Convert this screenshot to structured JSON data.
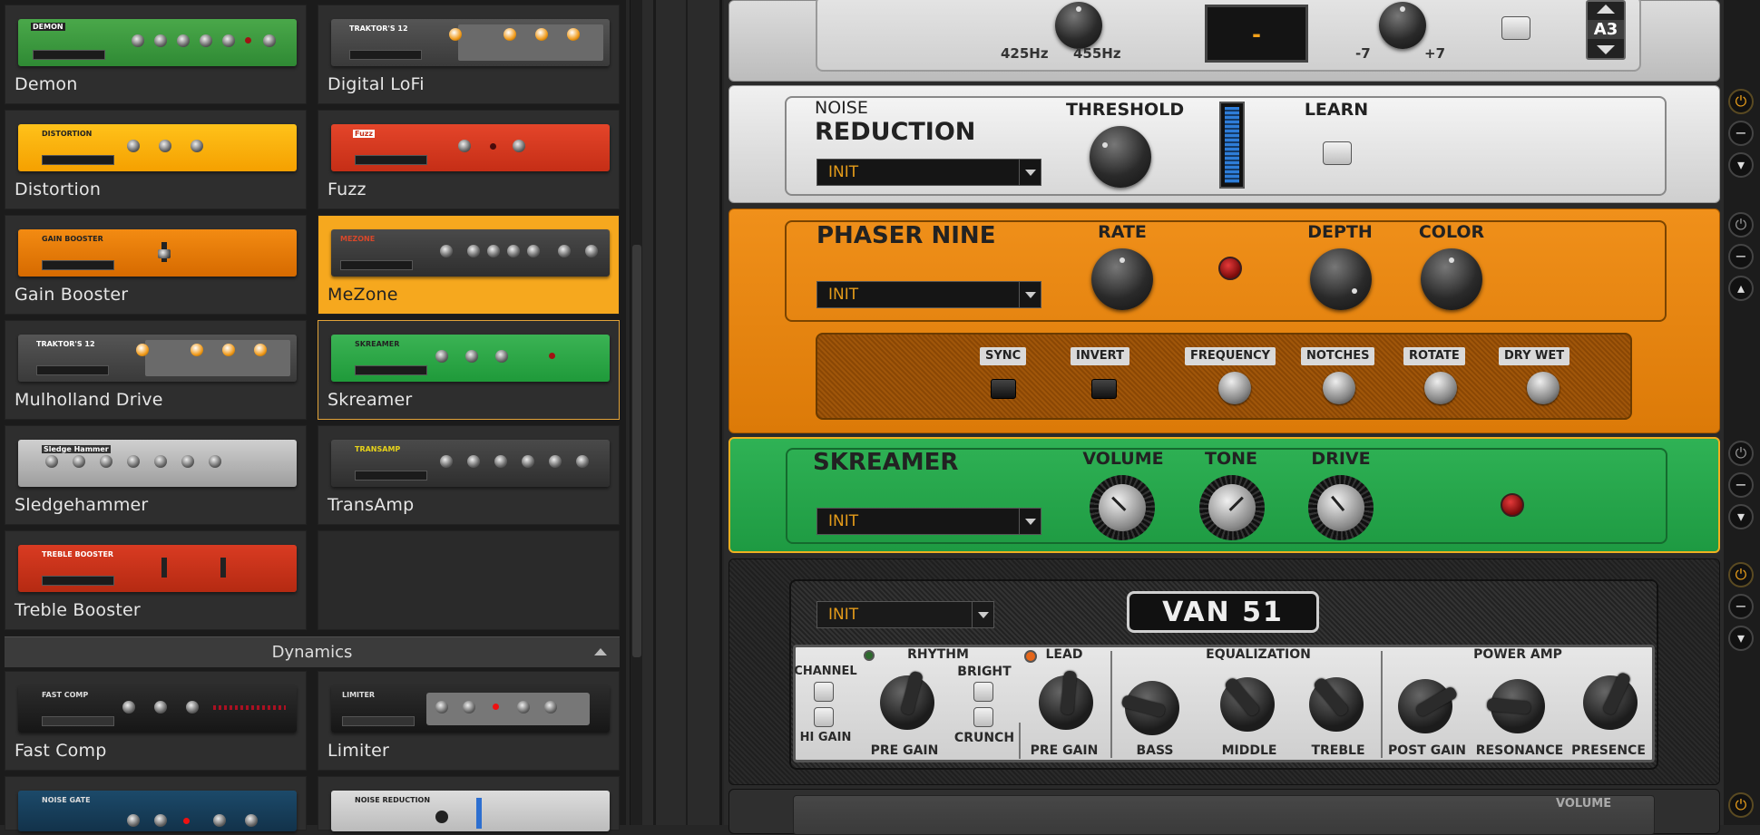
{
  "browser": {
    "tiles": [
      {
        "name": "Demon",
        "thumb_label": "DEMON"
      },
      {
        "name": "Digital LoFi",
        "thumb_label": "TRAKTOR'S 12"
      },
      {
        "name": "Distortion",
        "thumb_label": "DISTORTION"
      },
      {
        "name": "Fuzz",
        "thumb_label": "Fuzz"
      },
      {
        "name": "Gain Booster",
        "thumb_label": "GAIN BOOSTER"
      },
      {
        "name": "MeZone",
        "thumb_label": "MEZONE"
      },
      {
        "name": "Mulholland Drive",
        "thumb_label": "TRAKTOR'S 12"
      },
      {
        "name": "Skreamer",
        "thumb_label": "SKREAMER"
      },
      {
        "name": "Sledgehammer",
        "thumb_label": "Sledge Hammer"
      },
      {
        "name": "TransAmp",
        "thumb_label": "TRANSAMP"
      },
      {
        "name": "Treble Booster",
        "thumb_label": "TREBLE BOOSTER"
      }
    ],
    "section_header": "Dynamics",
    "dynamics_tiles": [
      {
        "name": "Fast Comp",
        "thumb_label": "FAST COMP"
      },
      {
        "name": "Limiter",
        "thumb_label": "LIMITER"
      },
      {
        "name": "",
        "thumb_label": "NOISE GATE"
      },
      {
        "name": "",
        "thumb_label": "NOISE REDUCTION"
      }
    ]
  },
  "rack": {
    "top_module": {
      "freq_low": "425Hz",
      "freq_high": "455Hz",
      "display_value": "-",
      "range_low": "-7",
      "range_high": "+7",
      "note": "A3"
    },
    "noise_reduction": {
      "title_line1": "NOISE",
      "title_line2": "REDUCTION",
      "preset": "INIT",
      "threshold_label": "THRESHOLD",
      "learn_label": "LEARN"
    },
    "phaser": {
      "title": "PHASER NINE",
      "preset": "INIT",
      "rate_label": "RATE",
      "depth_label": "DEPTH",
      "color_label": "COLOR",
      "sync_label": "SYNC",
      "invert_label": "INVERT",
      "frequency_label": "FREQUENCY",
      "notches_label": "NOTCHES",
      "rotate_label": "ROTATE",
      "drywet_label": "DRY WET"
    },
    "skreamer": {
      "title": "SKREAMER",
      "preset": "INIT",
      "volume_label": "VOLUME",
      "tone_label": "TONE",
      "drive_label": "DRIVE"
    },
    "van51": {
      "title": "VAN 51",
      "preset": "INIT",
      "channel_label": "CHANNEL",
      "higain_label": "HI GAIN",
      "rhythm_label": "RHYTHM",
      "bright_label": "BRIGHT",
      "crunch_label": "CRUNCH",
      "rhythm_pregain_label": "PRE GAIN",
      "lead_label": "LEAD",
      "lead_pregain_label": "PRE GAIN",
      "eq_label": "EQUALIZATION",
      "bass_label": "BASS",
      "middle_label": "MIDDLE",
      "treble_label": "TREBLE",
      "poweramp_label": "POWER AMP",
      "postgain_label": "POST GAIN",
      "resonance_label": "RESONANCE",
      "presence_label": "PRESENCE"
    },
    "bottom_module": {
      "volume_label": "VOLUME"
    }
  },
  "colors": {
    "accent": "#f6a81e",
    "orange_panel": "#e9840e",
    "green_panel": "#1f9e45",
    "preset_text": "#e49b1a"
  }
}
